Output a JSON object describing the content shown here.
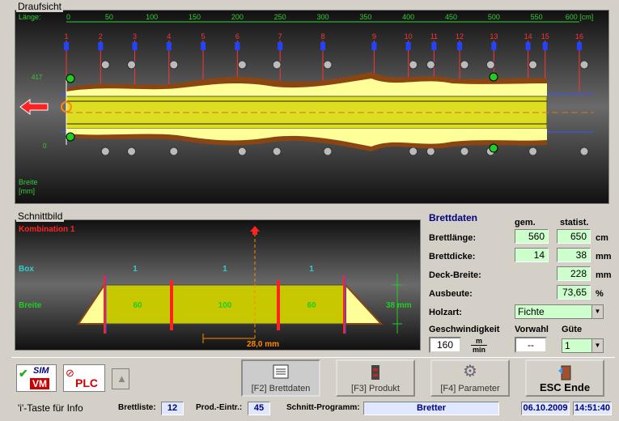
{
  "top_view": {
    "title": "Draufsicht",
    "length_label": "Länge:",
    "ruler_ticks": [
      "0",
      "50",
      "100",
      "150",
      "200",
      "250",
      "300",
      "350",
      "400",
      "450",
      "500",
      "550",
      "600 [cm]"
    ],
    "ruler_values": [
      0,
      50,
      100,
      150,
      200,
      250,
      300,
      350,
      400,
      450,
      500,
      550,
      600
    ],
    "saw_labels": [
      "1",
      "2",
      "3",
      "4",
      "5",
      "6",
      "7",
      "8",
      "9",
      "10",
      "11",
      "12",
      "13",
      "14",
      "15",
      "16"
    ],
    "saw_positions": [
      0,
      40,
      80,
      120,
      160,
      200,
      250,
      300,
      360,
      400,
      430,
      460,
      500,
      540,
      560,
      600
    ],
    "y_top_label": "417",
    "y_bottom_label": "0",
    "width_label_1": "Breite",
    "width_label_2": "[mm]"
  },
  "cut_view": {
    "title": "Schnittbild",
    "combination": "Kombination  1",
    "box_label": "Box",
    "width_label": "Breite",
    "box_values": [
      "1",
      "1",
      "1"
    ],
    "width_values": [
      "60",
      "100",
      "60"
    ],
    "height_value": "38 mm",
    "offset_value": "28,0 mm"
  },
  "board_data": {
    "title": "Brettdaten",
    "col_measured": "gem.",
    "col_stat": "statist.",
    "rows": [
      {
        "label": "Brettlänge:",
        "measured": "560",
        "stat": "650",
        "unit": "cm"
      },
      {
        "label": "Brettdicke:",
        "measured": "14",
        "stat": "38",
        "unit": "mm"
      },
      {
        "label": "Deck-Breite:",
        "measured": "",
        "stat": "228",
        "unit": "mm"
      },
      {
        "label": "Ausbeute:",
        "measured": "",
        "stat": "73,65",
        "unit": "%"
      }
    ],
    "wood_label": "Holzart:",
    "wood_value": "Fichte",
    "speed_label": "Geschwindigkeit",
    "speed_value": "160",
    "speed_unit_top": "m",
    "speed_unit_bottom": "min",
    "preselect_label": "Vorwahl",
    "preselect_value": "--",
    "quality_label": "Güte",
    "quality_value": "1"
  },
  "toolbar": {
    "sim_label": "SIM",
    "vm_label": "VM",
    "plc_label": "PLC",
    "f2": "[F2] Brettdaten",
    "f3": "[F3] Produkt",
    "f4": "[F4] Parameter",
    "esc": "ESC Ende"
  },
  "status": {
    "info": "'i'-Taste für Info",
    "board_list_label": "Brettliste:",
    "board_list_value": "12",
    "prod_label": "Prod.-Eintr.:",
    "prod_value": "45",
    "program_label": "Schnitt-Programm:",
    "program_value": "Bretter",
    "date": "06.10.2009",
    "time": "14:51:40"
  },
  "colors": {
    "board": "#ffff99",
    "bark": "#8b4513",
    "accent": "#000080",
    "saw": "#ff3333",
    "green": "#ccffcc"
  }
}
